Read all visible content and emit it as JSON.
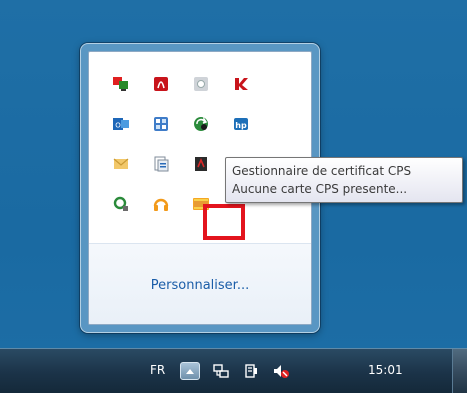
{
  "flyout": {
    "customize_label": "Personnaliser...",
    "icons": [
      {
        "name": "network-monitor-icon"
      },
      {
        "name": "acrobat-icon"
      },
      {
        "name": "media-icon"
      },
      {
        "name": "kaspersky-icon"
      },
      {
        "name": "outlook-icon"
      },
      {
        "name": "calculator-app-icon"
      },
      {
        "name": "sync-arrows-icon"
      },
      {
        "name": "hp-printer-icon"
      },
      {
        "name": "mail-envelope-icon"
      },
      {
        "name": "documents-icon"
      },
      {
        "name": "pdf-tool-icon"
      },
      {
        "name": "magnifier-icon"
      },
      {
        "name": "headset-icon"
      },
      {
        "name": "cps-card-icon"
      }
    ]
  },
  "tooltip": {
    "line1": "Gestionnaire de certificat CPS",
    "line2": "Aucune carte CPS presente..."
  },
  "taskbar": {
    "language": "FR",
    "clock": "15:01"
  },
  "colors": {
    "highlight": "#e3141d",
    "link": "#1a5da8",
    "desktop": "#1f6fa6"
  }
}
